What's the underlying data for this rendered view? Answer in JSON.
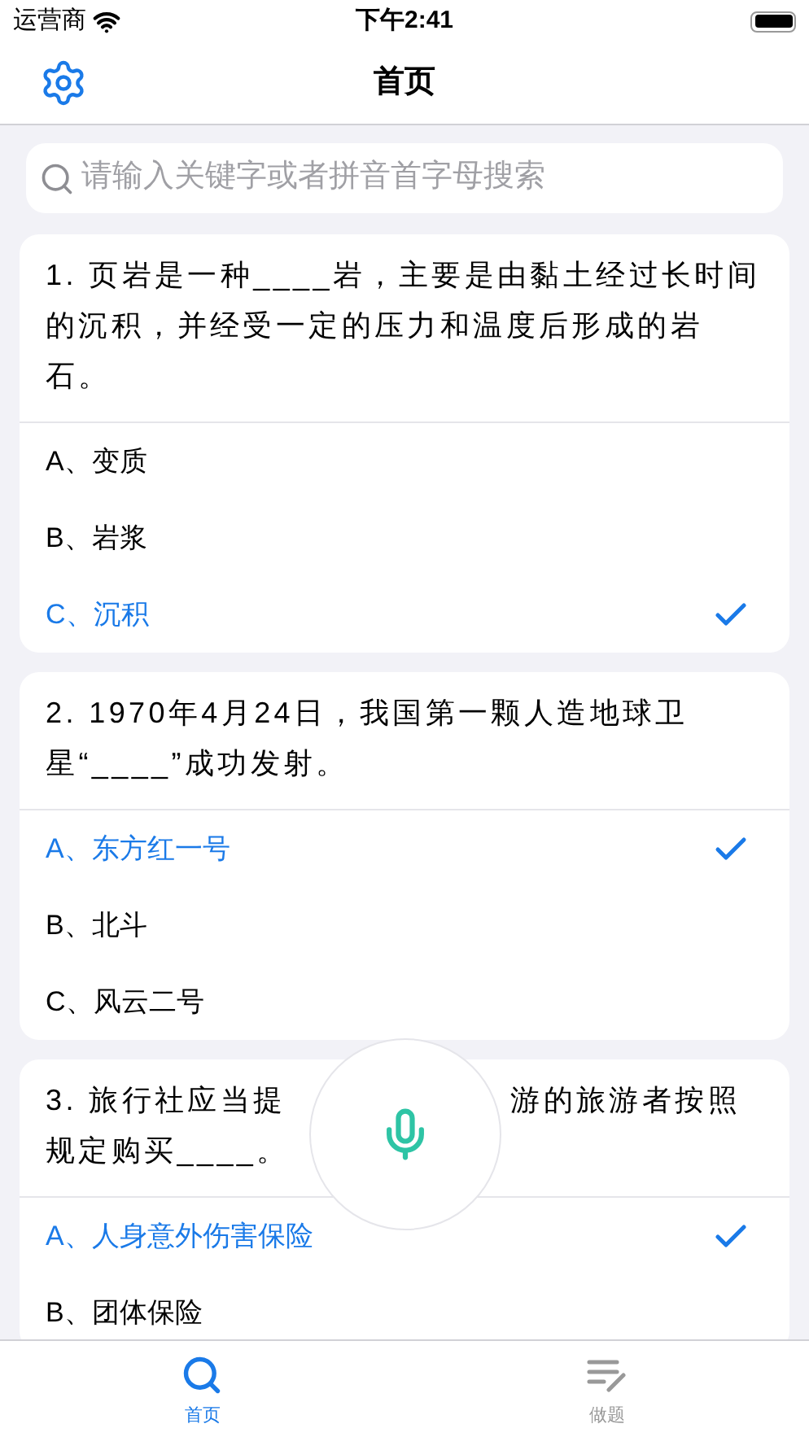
{
  "status_bar": {
    "carrier": "运营商",
    "time": "下午2:41"
  },
  "nav": {
    "title": "首页"
  },
  "search": {
    "placeholder": "请输入关键字或者拼音首字母搜索"
  },
  "questions": [
    {
      "kind": "full",
      "text": "1. 页岩是一种____岩，主要是由黏土经过长时间的沉积，并经受一定的压力和温度后形成的岩石。",
      "options": [
        {
          "label": "A、变质",
          "selected": false
        },
        {
          "label": "B、岩浆",
          "selected": false
        },
        {
          "label": "C、沉积",
          "selected": true
        }
      ]
    },
    {
      "kind": "full",
      "text": "2. 1970年4月24日，我国第一颗人造地球卫星“____”成功发射。",
      "options": [
        {
          "label": "A、东方红一号",
          "selected": true
        },
        {
          "label": "B、北斗",
          "selected": false
        },
        {
          "label": "C、风云二号",
          "selected": false
        }
      ]
    },
    {
      "kind": "covered",
      "parts": [
        "3. 旅行社应当提",
        "游的旅游者按照",
        "规定购买____。"
      ],
      "options": [
        {
          "label": "A、人身意外伤害保险",
          "selected": true
        },
        {
          "label": "B、团体保险",
          "selected": false
        }
      ]
    }
  ],
  "tabs": [
    {
      "label": "首页",
      "selected": true
    },
    {
      "label": "做题",
      "selected": false
    }
  ]
}
